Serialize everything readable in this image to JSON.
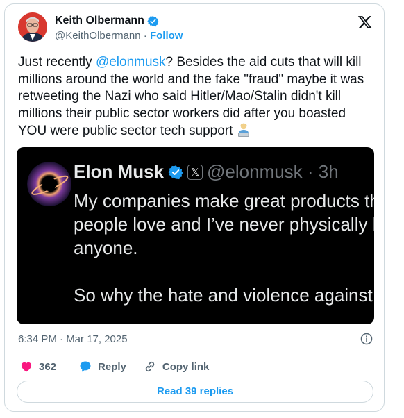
{
  "author": {
    "name": "Keith Olbermann",
    "handle": "@KeithOlbermann",
    "separator": " · ",
    "follow_label": "Follow"
  },
  "tweet": {
    "mention": "@elonmusk",
    "text_before": "Just recently ",
    "text_after": "? Besides the aid cuts that will kill millions around the world and the fake \"fraud\" maybe it was retweeting the Nazi who said Hitler/Mao/Stalin didn't kill millions their public sector workers did after you boasted YOU were public sector tech support "
  },
  "embedded": {
    "name": "Elon Musk",
    "badge": "𝕏",
    "handle_time": "@elonmusk · 3h",
    "text": "My companies make great products that\npeople love and I’ve never physically hurt\nanyone.\n\nSo why the hate and violence against me?"
  },
  "timestamp": "6:34 PM · Mar 17, 2025",
  "actions": {
    "like_count": "362",
    "reply_label": "Reply",
    "copy_label": "Copy link"
  },
  "read_replies_label": "Read 39 replies",
  "colors": {
    "accent": "#1d9bf0",
    "like": "#f91880",
    "secondary_text": "#536471"
  },
  "icons": [
    "x-logo-icon",
    "verified-badge-icon",
    "info-icon",
    "heart-icon",
    "reply-bubble-icon",
    "link-icon",
    "man-technologist-emoji-icon"
  ]
}
